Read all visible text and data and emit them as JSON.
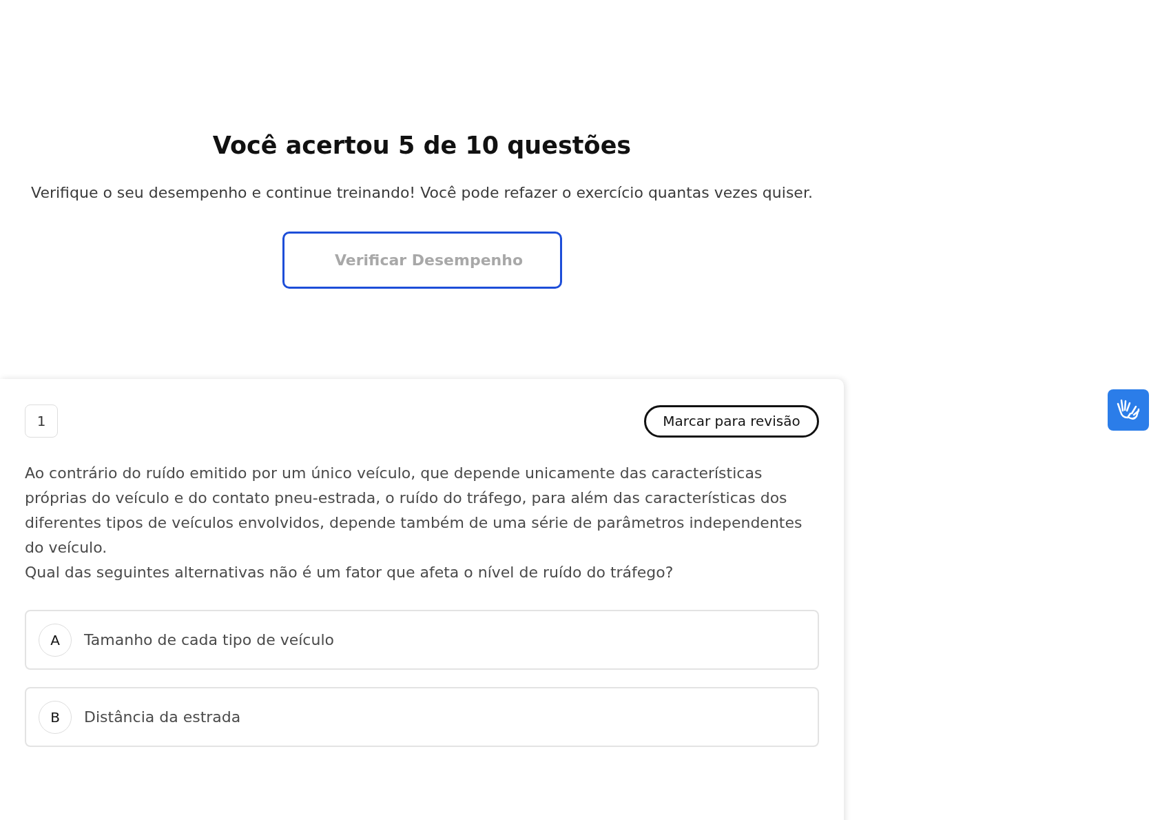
{
  "result": {
    "title": "Você acertou 5 de 10 questões",
    "message": "Verifique o seu desempenho e continue treinando! Você pode refazer o exercício quantas vezes quiser.",
    "button": "Verificar Desempenho"
  },
  "question": {
    "number": "1",
    "review_button": "Marcar para revisão",
    "paragraphs": [
      "Ao contrário do ruído emitido por um único veículo, que depende unicamente das características próprias do veículo e do contato pneu-estrada, o ruído do tráfego, para além das características dos diferentes tipos de veículos envolvidos, depende também de uma série de parâmetros independentes do veículo.",
      "Qual das seguintes alternativas não é um fator que afeta o nível de ruído do tráfego?"
    ],
    "options": [
      {
        "letter": "A",
        "text": "Tamanho de cada tipo de veículo",
        "selected": false
      },
      {
        "letter": "B",
        "text": "Distância da estrada",
        "selected": false
      }
    ]
  }
}
